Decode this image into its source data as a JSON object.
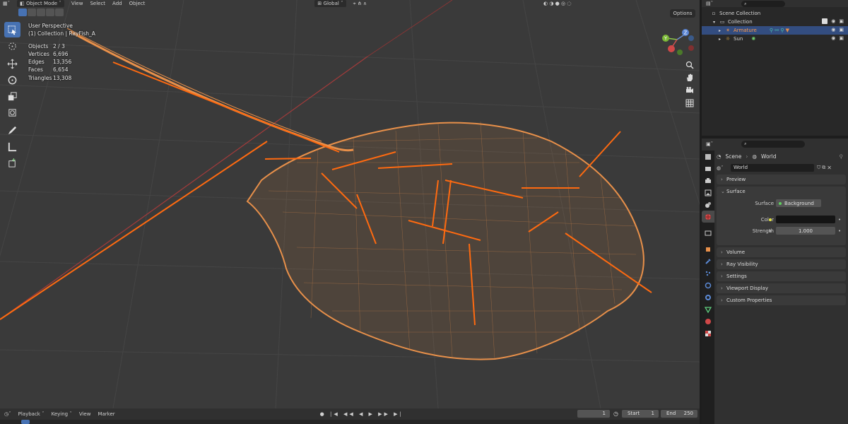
{
  "header": {
    "mode": "Object Mode",
    "menus": [
      "View",
      "Select",
      "Add",
      "Object"
    ],
    "orientation": "Global",
    "options": "Options"
  },
  "viewport_stats": {
    "view_name": "User Perspective",
    "context": "(1) Collection | RayFish_A",
    "rows": [
      {
        "label": "Objects",
        "value": "2 / 3"
      },
      {
        "label": "Vertices",
        "value": "6,696"
      },
      {
        "label": "Edges",
        "value": "13,356"
      },
      {
        "label": "Faces",
        "value": "6,654"
      },
      {
        "label": "Triangles",
        "value": "13,308"
      }
    ]
  },
  "gizmo": {
    "x": "X",
    "y": "Y",
    "z": "Z"
  },
  "timeline": {
    "menus": [
      "Playback",
      "Keying",
      "View",
      "Marker"
    ],
    "current_frame": "1",
    "start_label": "Start",
    "start_value": "1",
    "end_label": "End",
    "end_value": "250"
  },
  "outliner": {
    "items": [
      {
        "label": "Scene Collection"
      },
      {
        "label": "Collection"
      },
      {
        "label": "Armature"
      },
      {
        "label": "Sun"
      }
    ]
  },
  "properties": {
    "breadcrumb_scene": "Scene",
    "breadcrumb_world": "World",
    "world_name": "World",
    "panels": {
      "preview": "Preview",
      "surface": "Surface",
      "volume": "Volume",
      "ray_visibility": "Ray Visibility",
      "settings": "Settings",
      "viewport_display": "Viewport Display",
      "custom_properties": "Custom Properties"
    },
    "surface": {
      "surface_label": "Surface",
      "surface_value": "Background",
      "color_label": "Color",
      "strength_label": "Strength",
      "strength_value": "1.000"
    }
  },
  "colors": {
    "accent": "#4772b3",
    "wire": "#e8904a",
    "bone": "#ff6a10",
    "selected_row": "#334d80"
  }
}
